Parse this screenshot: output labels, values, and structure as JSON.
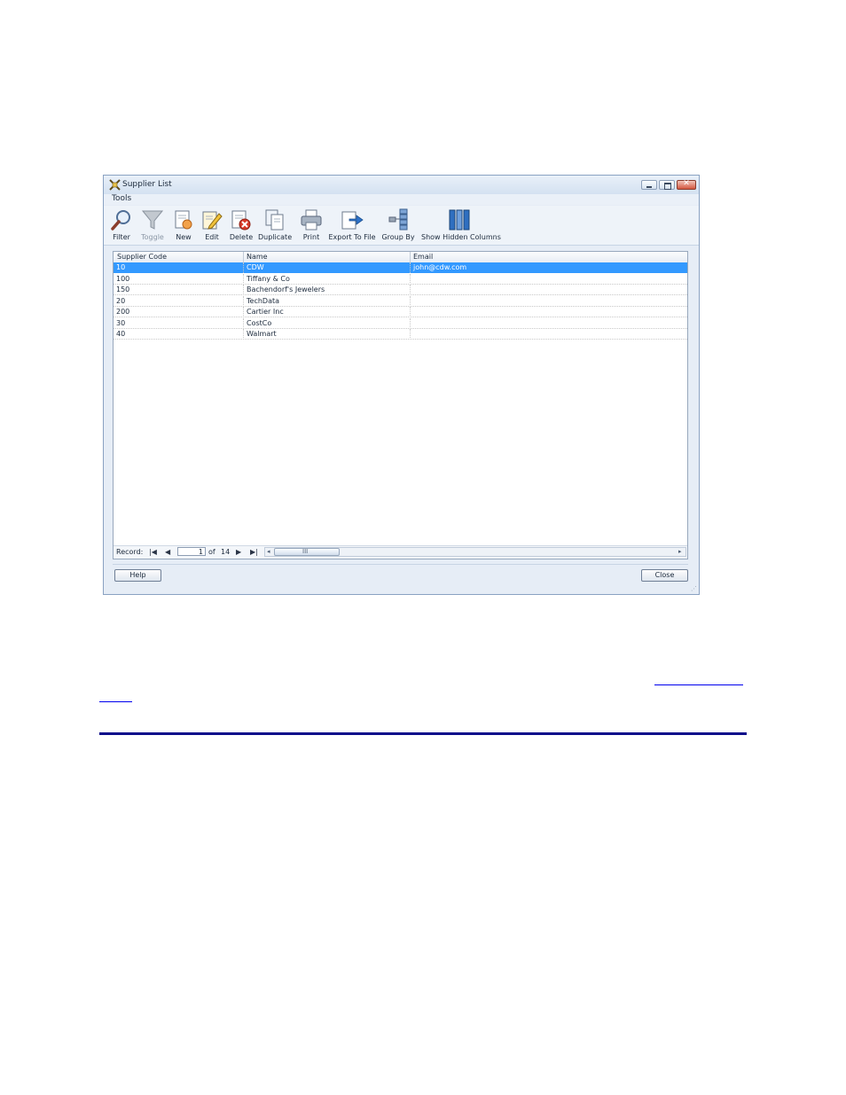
{
  "window": {
    "title": "Supplier List",
    "menu": [
      "Tools"
    ]
  },
  "toolbar": [
    {
      "label": "Filter",
      "icon": "magnifier-icon",
      "enabled": true
    },
    {
      "label": "Toggle",
      "icon": "funnel-icon",
      "enabled": false
    },
    {
      "label": "New",
      "icon": "new-document-icon",
      "enabled": true
    },
    {
      "label": "Edit",
      "icon": "edit-pencil-icon",
      "enabled": true
    },
    {
      "label": "Delete",
      "icon": "delete-icon",
      "enabled": true
    },
    {
      "label": "Duplicate",
      "icon": "duplicate-icon",
      "enabled": true
    },
    {
      "label": "Print",
      "icon": "printer-icon",
      "enabled": true
    },
    {
      "label": "Export To File",
      "icon": "export-icon",
      "enabled": true
    },
    {
      "label": "Group By",
      "icon": "group-by-icon",
      "enabled": true
    },
    {
      "label": "Show Hidden Columns",
      "icon": "columns-icon",
      "enabled": true
    }
  ],
  "grid": {
    "columns": [
      "Supplier Code",
      "Name",
      "Email"
    ],
    "rows": [
      {
        "code": "10",
        "name": "CDW",
        "email": "john@cdw.com",
        "selected": true
      },
      {
        "code": "100",
        "name": "Tiffany & Co",
        "email": "",
        "selected": false
      },
      {
        "code": "150",
        "name": "Bachendorf's Jewelers",
        "email": "",
        "selected": false
      },
      {
        "code": "20",
        "name": "TechData",
        "email": "",
        "selected": false
      },
      {
        "code": "200",
        "name": "Cartier Inc",
        "email": "",
        "selected": false
      },
      {
        "code": "30",
        "name": "CostCo",
        "email": "",
        "selected": false
      },
      {
        "code": "40",
        "name": "Walmart",
        "email": "",
        "selected": false
      }
    ]
  },
  "navigator": {
    "label": "Record:",
    "current": "1",
    "of_label": "of",
    "total": "14",
    "scroll_grip": "III"
  },
  "buttons": {
    "help": "Help",
    "close": "Close"
  },
  "colors": {
    "selection": "#3399ff",
    "link": "#0000ee",
    "rule": "#0a0a8a"
  }
}
